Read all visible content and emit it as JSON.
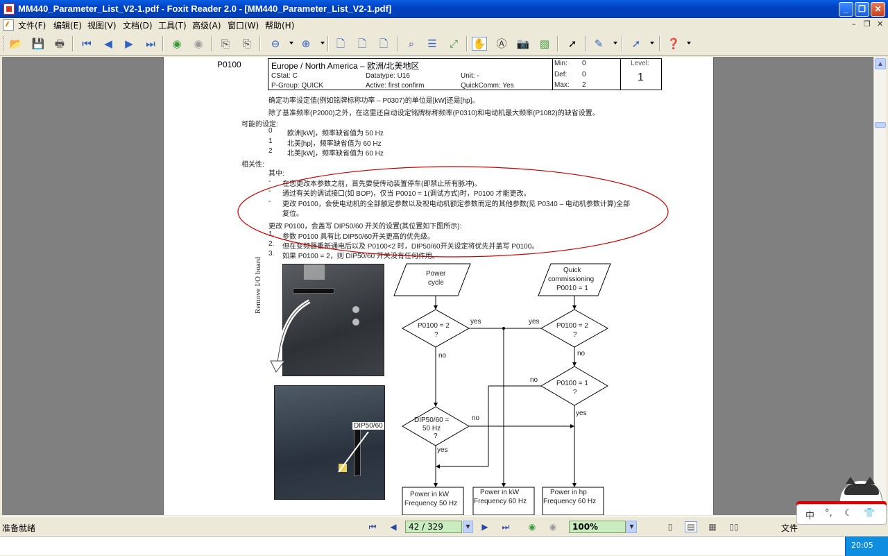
{
  "window": {
    "title": "MM440_Parameter_List_V2-1.pdf - Foxit Reader 2.0 - [MM440_Parameter_List_V2-1.pdf]"
  },
  "menu": {
    "items": [
      "文件(F)",
      "编辑(E)",
      "视图(V)",
      "文档(D)",
      "工具(T)",
      "高级(A)",
      "窗口(W)",
      "帮助(H)"
    ]
  },
  "document": {
    "param_id": "P0100",
    "param_title": "Europe / North America – 欧洲/北美地区",
    "cstat": "CStat: C",
    "datatype": "Datatype: U16",
    "unit": "Unit: -",
    "pgroup": "P-Group: QUICK",
    "active": "Active: first confirm",
    "quickcomm": "QuickComm: Yes",
    "min_label": "Min:",
    "min_val": "0",
    "def_label": "Def:",
    "def_val": "0",
    "max_label": "Max:",
    "max_val": "2",
    "level_label": "Level:",
    "level_val": "1",
    "desc1": "确定功率设定值(例如铭牌标称功率 – P0307)的单位是[kW]还是[hp]。",
    "desc2": "除了基准频率(P2000)之外，在这里还自动设定铭牌标称频率(P0310)和电动机最大频率(P1082)的缺省设置。",
    "settings_title": "可能的设定:",
    "settings": [
      {
        "num": "0",
        "text": "欧洲[kW]，频率缺省值为 50 Hz"
      },
      {
        "num": "1",
        "text": "北美[hp]，频率缺省值为 60 Hz"
      },
      {
        "num": "2",
        "text": "北美[kW]，频率缺省值为 60 Hz"
      }
    ],
    "related_title": "相关性:",
    "related_intro": "其中:",
    "related_items": [
      "在您更改本参数之前，首先要使传动装置停车(即禁止所有脉冲)。",
      "通过有关的调试接口(如 BOP)，仅当 P0010 = 1(调试方式)时，P0100 才能更改。",
      "更改 P0100，会使电动机的全部额定参数以及视电动机额定参数而定的其他参数(见 P0340 – 电动机参数计算)全部",
      "复位。"
    ],
    "change_intro": "更改 P0100，会盖写 DIP50/60 开关的设置(其位置如下图所示):",
    "change_items": [
      {
        "num": "1.",
        "text": "参数 P0100 具有比 DIP50/60开关更高的优先级。"
      },
      {
        "num": "2.",
        "text": "但在变频器重新通电后以及 P0100<2 时，DIP50/60开关设定将优先并盖写 P0100。"
      },
      {
        "num": "3.",
        "text": "如果 P0100 = 2，则 DIP50/60 开关没有任何作用。"
      }
    ],
    "photo_label": "Remove I/O board",
    "dip_label": "DIP50/60",
    "flow": {
      "power_cycle": [
        "Power",
        "cycle"
      ],
      "quick_comm": [
        "Quick",
        "commissioning",
        "P0010 = 1"
      ],
      "d1": [
        "P0100 = 2",
        "?"
      ],
      "d2": [
        "P0100 = 2",
        "?"
      ],
      "d3": [
        "P0100 = 1",
        "?"
      ],
      "d4": [
        "DIP50/60 =",
        "50 Hz",
        "?"
      ],
      "yes": "yes",
      "no": "no",
      "out1": [
        "Power in kW",
        "Frequency 50 Hz"
      ],
      "out2": [
        "Power in kW",
        "Frequency 60 Hz"
      ],
      "out3": [
        "Power in hp",
        "Frequency 60 Hz"
      ]
    }
  },
  "status": {
    "ready": "准备就绪",
    "page": "42 / 329",
    "zoom": "100%",
    "file_label": "文件",
    "clock": "20:05"
  },
  "ime": {
    "chars": [
      "中",
      "°,",
      "☾",
      "👕"
    ]
  },
  "colors": {
    "titlebar": "#0041c3",
    "annotation": "#cc0000",
    "page_bg": "#808080"
  }
}
